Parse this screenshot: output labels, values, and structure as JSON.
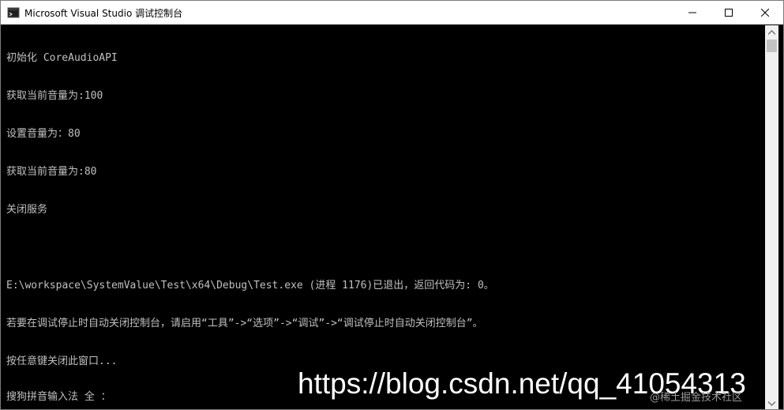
{
  "window": {
    "title": "Microsoft Visual Studio 调试控制台",
    "icon": "console-app-icon",
    "controls": {
      "minimize_icon": "minimize-icon",
      "maximize_icon": "maximize-icon",
      "close_icon": "close-icon"
    }
  },
  "console": {
    "lines": [
      "初始化 CoreAudioAPI",
      "获取当前音量为:100",
      "设置音量为：80",
      "获取当前音量为:80",
      "关闭服务",
      "",
      "E:\\workspace\\SystemValue\\Test\\x64\\Debug\\Test.exe (进程 1176)已退出，返回代码为: 0。",
      "若要在调试停止时自动关闭控制台，请启用“工具”->“选项”->“调试”->“调试停止时自动关闭控制台”。",
      "按任意键关闭此窗口..."
    ],
    "ime_status": "搜狗拼音输入法 全 ："
  },
  "overlay": {
    "watermark_url": "https://blog.csdn.net/qq_41054313",
    "watermark_handle": "@稀土掘金技术社区"
  },
  "colors": {
    "console_bg": "#000000",
    "console_fg": "#c0c0c0",
    "titlebar_bg": "#ffffff"
  }
}
